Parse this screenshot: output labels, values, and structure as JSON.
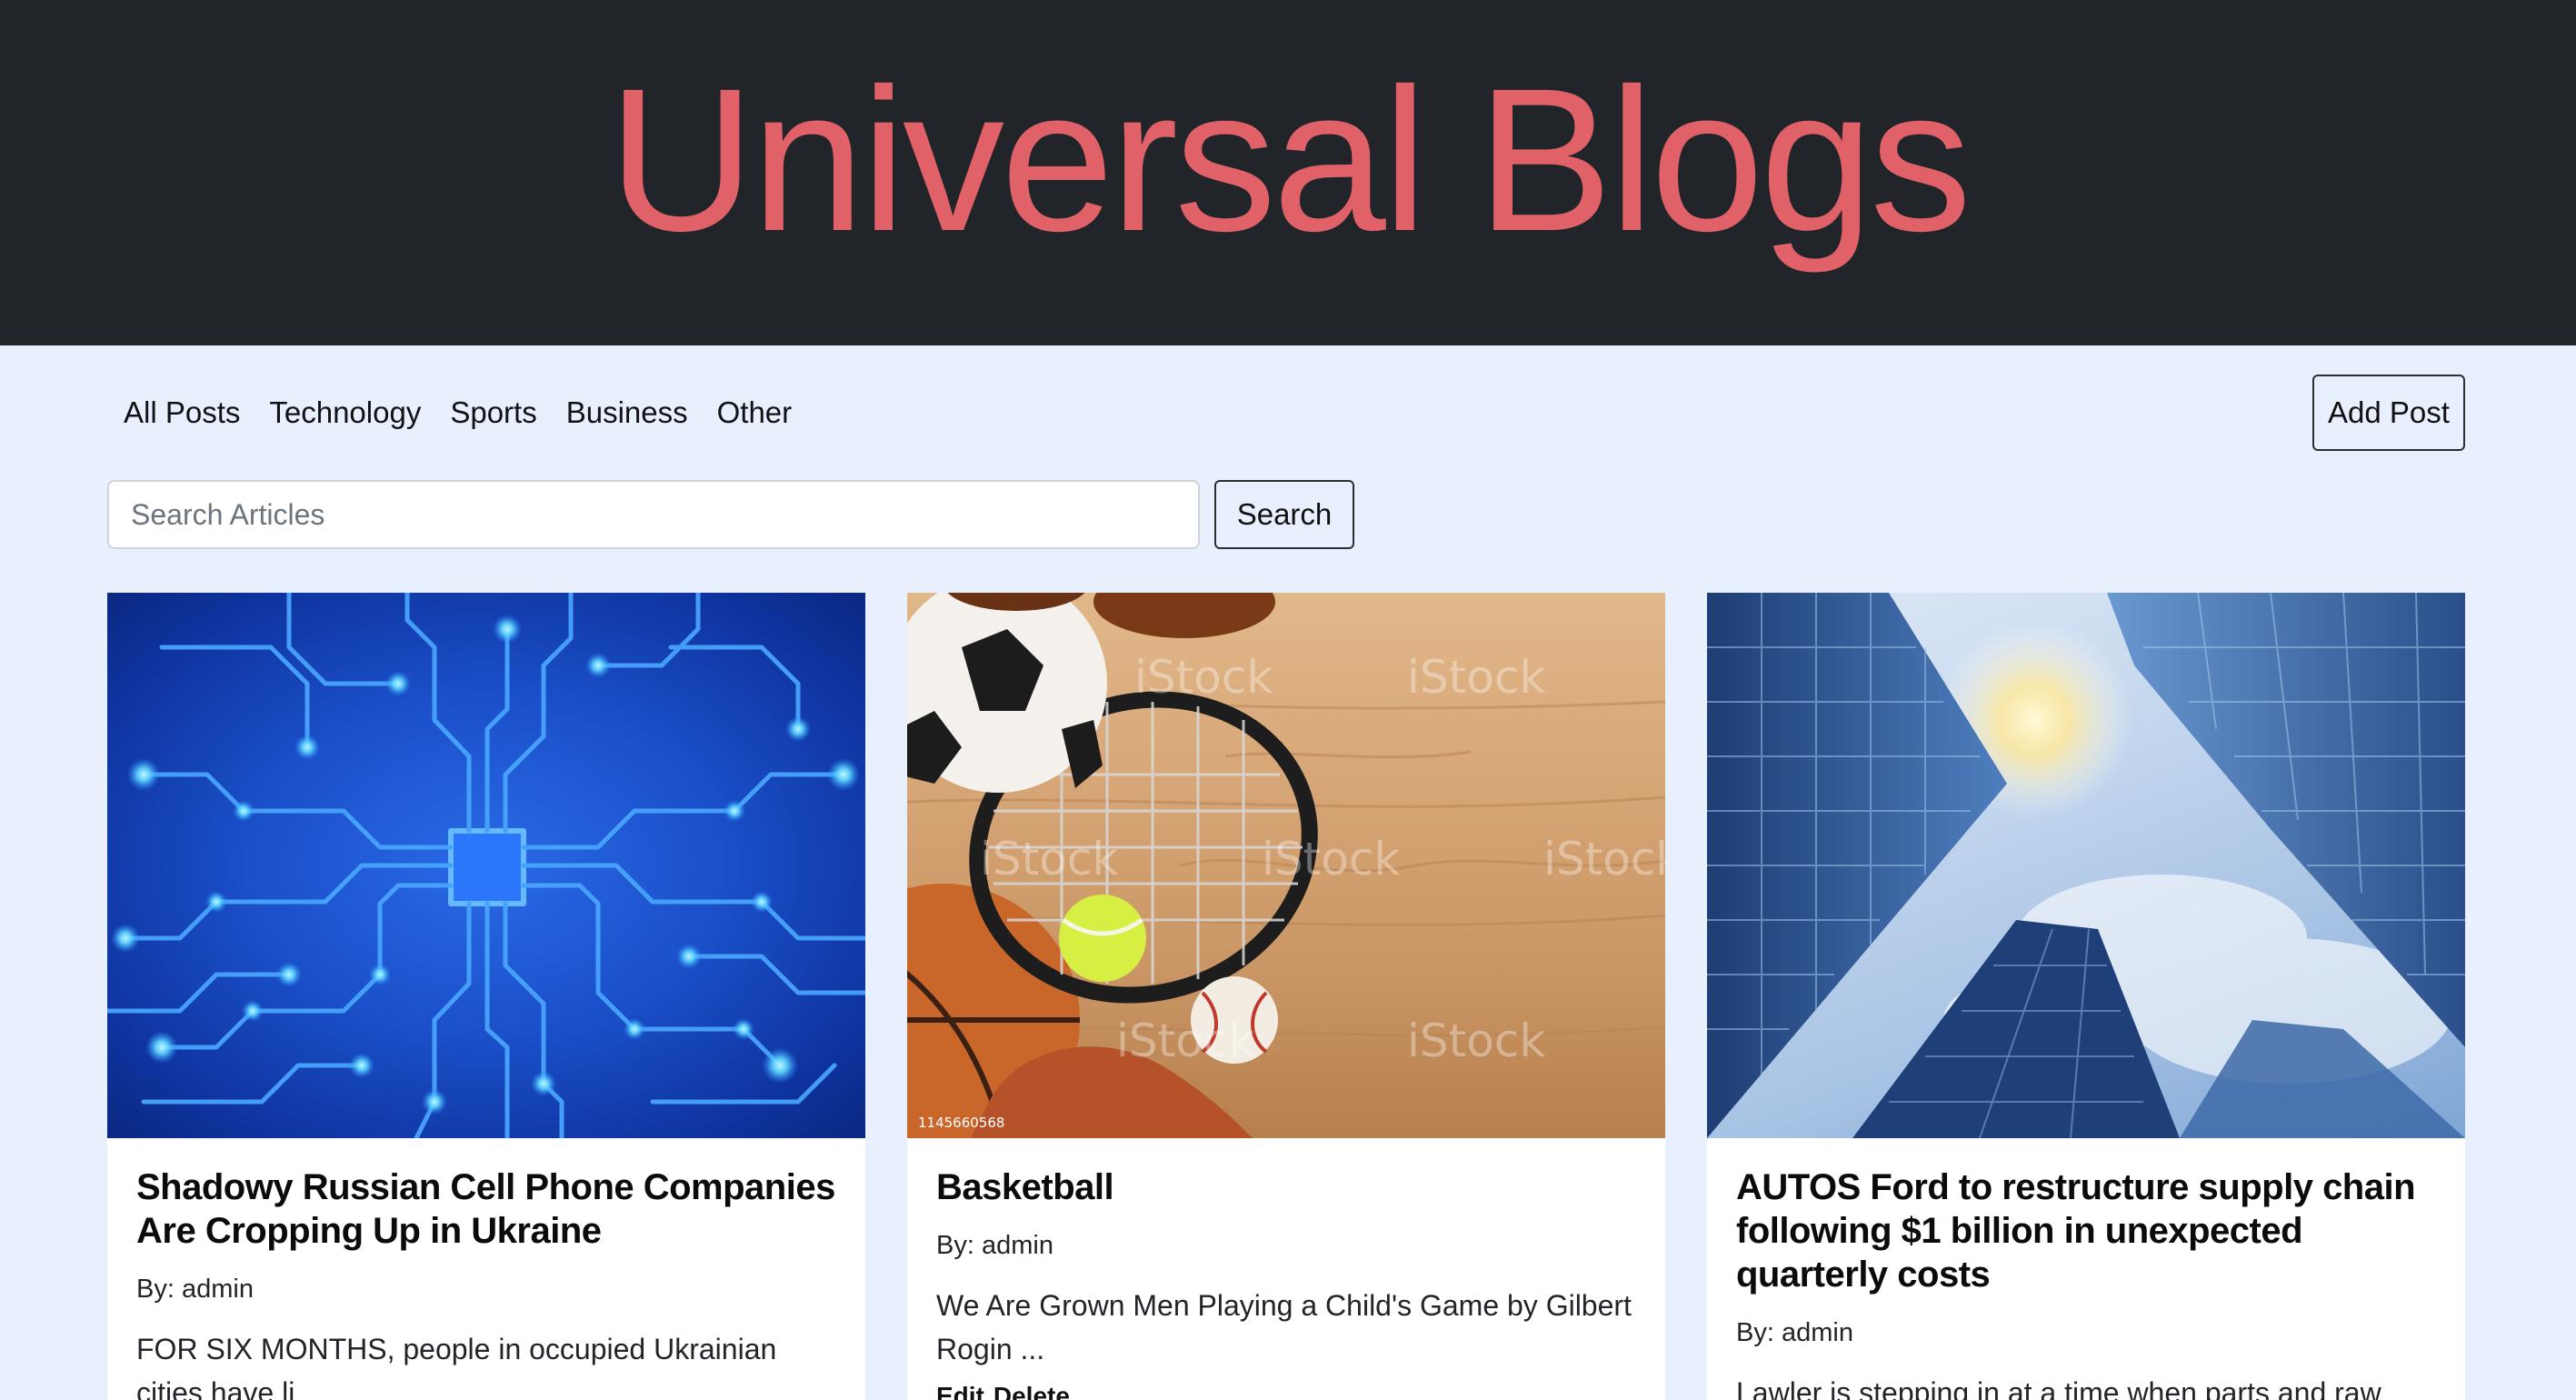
{
  "header": {
    "title": "Universal Blogs"
  },
  "nav": {
    "links": [
      {
        "label": "All Posts"
      },
      {
        "label": "Technology"
      },
      {
        "label": "Sports"
      },
      {
        "label": "Business"
      },
      {
        "label": "Other"
      }
    ],
    "add_post_label": "Add Post"
  },
  "search": {
    "placeholder": "Search Articles",
    "value": "",
    "button_label": "Search"
  },
  "posts": [
    {
      "image": "circuit-board-image",
      "title": "Shadowy Russian Cell Phone Companies Are Cropping Up in Ukraine",
      "author": "By: admin",
      "excerpt": "FOR SIX MONTHS, people in occupied Ukrainian cities have li",
      "actions": []
    },
    {
      "image": "sports-equipment-image",
      "image_watermark": "iStock",
      "image_id": "1145660568",
      "title": "Basketball",
      "author": "By: admin",
      "excerpt": "We Are Grown Men Playing a Child's Game by Gilbert Rogin ...",
      "actions": [
        "Edit",
        "Delete"
      ]
    },
    {
      "image": "skyscrapers-image",
      "title": "AUTOS Ford to restructure supply chain following $1 billion in unexpected quarterly costs",
      "author": "By: admin",
      "excerpt": "Lawler is stepping in at a time when parts and raw",
      "actions": []
    }
  ],
  "colors": {
    "header_bg": "#212429",
    "title": "#e06167",
    "page_bg": "#e8f0fd"
  }
}
